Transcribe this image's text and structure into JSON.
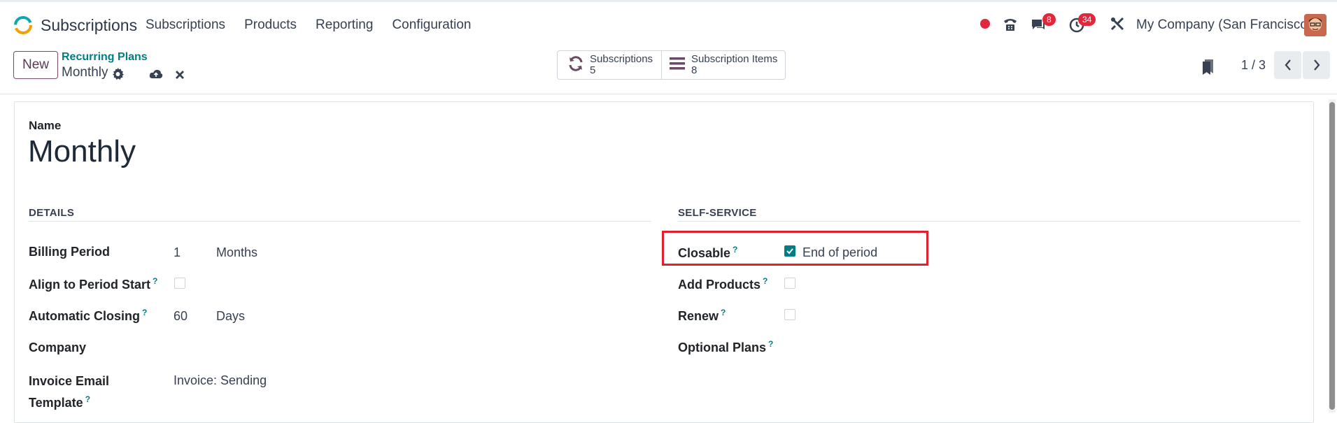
{
  "navbar": {
    "app_name": "Subscriptions",
    "menu": [
      "Subscriptions",
      "Products",
      "Reporting",
      "Configuration"
    ],
    "messages_count": "8",
    "activities_count": "34",
    "company": "My Company (San Francisco)"
  },
  "control_panel": {
    "new_label": "New",
    "breadcrumb_parent": "Recurring Plans",
    "breadcrumb_current": "Monthly",
    "smart_buttons": [
      {
        "label": "Subscriptions",
        "count": "5"
      },
      {
        "label": "Subscription Items",
        "count": "8"
      }
    ],
    "pager": "1 / 3"
  },
  "form": {
    "name_label": "Name",
    "name_value": "Monthly",
    "details": {
      "title": "DETAILS",
      "billing_period_label": "Billing Period",
      "billing_period_value": "1",
      "billing_period_unit": "Months",
      "align_label": "Align to Period Start",
      "align_checked": false,
      "auto_close_label": "Automatic Closing",
      "auto_close_value": "60",
      "auto_close_unit": "Days",
      "company_label": "Company",
      "invoice_email_label_1": "Invoice Email",
      "invoice_email_label_2": "Template",
      "invoice_email_value": "Invoice: Sending"
    },
    "self_service": {
      "title": "SELF-SERVICE",
      "closable_label": "Closable",
      "closable_checked": true,
      "closable_option": "End of period",
      "add_products_label": "Add Products",
      "add_products_checked": false,
      "renew_label": "Renew",
      "renew_checked": false,
      "optional_plans_label": "Optional Plans"
    },
    "help_marker": "?"
  },
  "colors": {
    "accent": "#017e84",
    "brand": "#714b67",
    "highlight": "#e0202c",
    "badge": "#e0273c"
  }
}
